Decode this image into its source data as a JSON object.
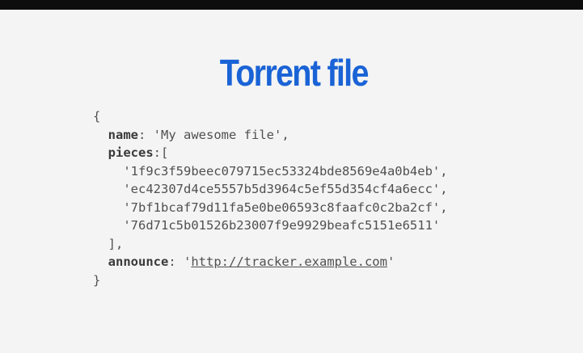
{
  "slide": {
    "title": "Torrent file",
    "code": {
      "open_brace": "{",
      "name_key": "name",
      "name_value": "'My awesome file'",
      "pieces_key": "pieces",
      "pieces_open": "[",
      "pieces": [
        "'1f9c3f59beec079715ec53324bde8569e4a0b4eb',",
        "'ec42307d4ce5557b5d3964c5ef55d354cf4a6ecc',",
        "'7bf1bcaf79d11fa5e0be06593c8faafc0c2ba2cf',",
        "'76d71c5b01526b23007f9e9929beafc5151e6511'"
      ],
      "pieces_close": "],",
      "announce_key": "announce",
      "announce_quote_open": "'",
      "announce_url": "http://tracker.example.com",
      "announce_quote_close": "'",
      "close_brace": "}"
    }
  }
}
